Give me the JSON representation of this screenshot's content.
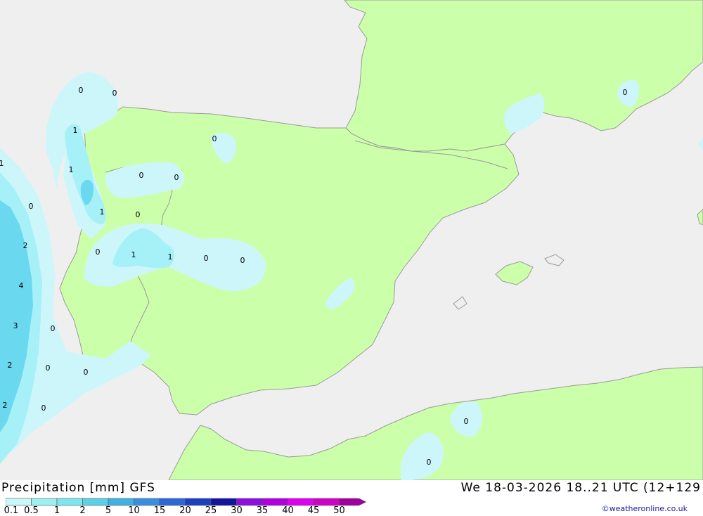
{
  "header": {
    "title": "Precipitation [mm] GFS",
    "datetime": "We 18-03-2026 18..21 UTC (12+129",
    "credit": "©weatheronline.co.uk"
  },
  "legend": {
    "ticks": [
      "0.1",
      "0.5",
      "1",
      "2",
      "5",
      "10",
      "15",
      "20",
      "25",
      "30",
      "35",
      "40",
      "45",
      "50"
    ],
    "colors": [
      "#c8f8f8",
      "#9ef0f0",
      "#7ee6ee",
      "#5cd0e8",
      "#3fb2e2",
      "#3a8ee0",
      "#2e68d6",
      "#1e40c0",
      "#14149c",
      "#8a10e0",
      "#b000e0",
      "#e000f0",
      "#d000c8",
      "#a000a0"
    ]
  },
  "map": {
    "colors": {
      "sea": "#efefef",
      "land": "#ccffaa",
      "precip_light": "#cdf6fb",
      "precip_medium": "#a6f0f8",
      "precip_heavy": "#6ad8ee",
      "border": "#9a9a9a"
    },
    "labels": [
      "0",
      "0",
      "1",
      "0",
      "1",
      "0",
      "0",
      "1",
      "0",
      "0",
      "1",
      "1",
      "0",
      "0",
      "0",
      "2",
      "4",
      "3",
      "0",
      "2",
      "0",
      "0",
      "2",
      "0",
      "0",
      "0",
      "0",
      "1"
    ]
  }
}
